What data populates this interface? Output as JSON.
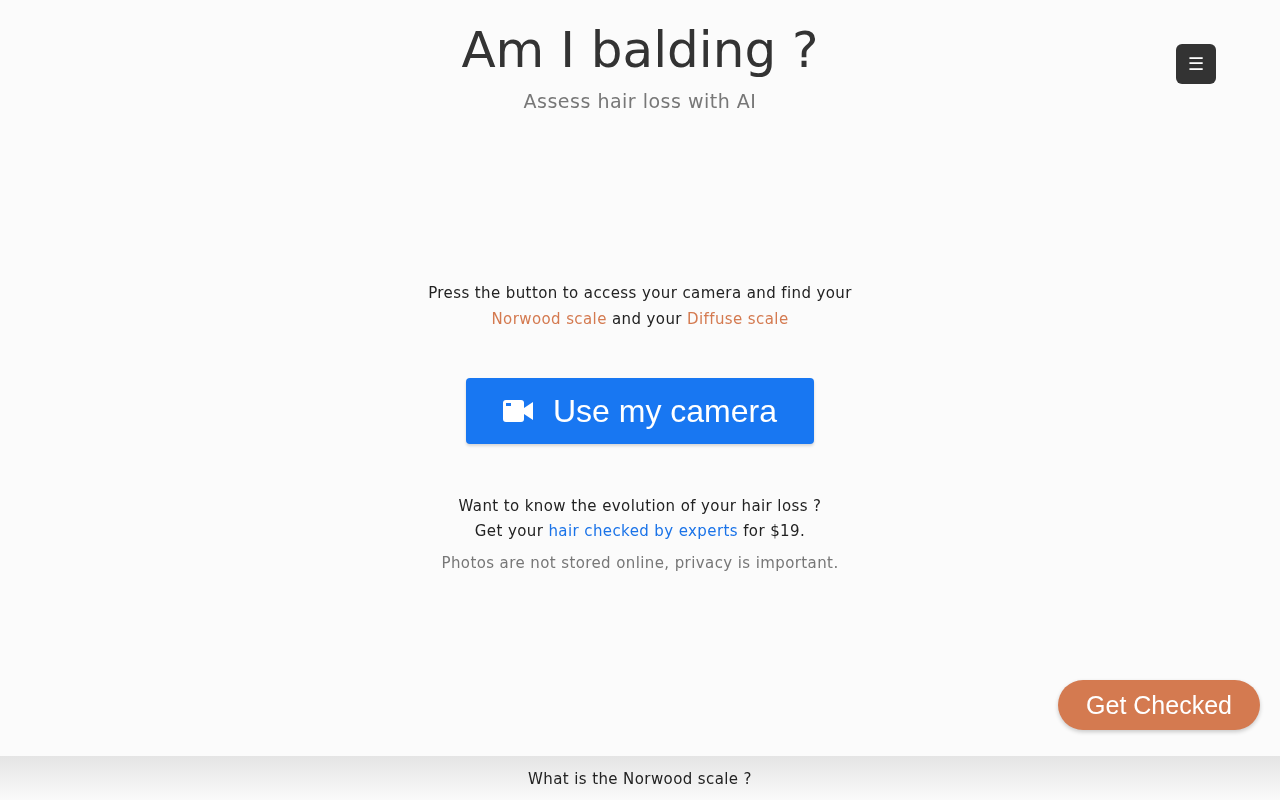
{
  "header": {
    "title": "Am I balding ?",
    "subtitle": "Assess hair loss with AI",
    "menu_icon": "☰"
  },
  "intro": [
    {
      "kind": "text",
      "text": "Press the button to access your camera and find your "
    },
    {
      "kind": "link",
      "text": "Norwood scale",
      "color": "#d47a50"
    },
    {
      "kind": "text",
      "text": " and your "
    },
    {
      "kind": "link",
      "text": "Diffuse scale",
      "color": "#d47a50"
    }
  ],
  "camera_button": {
    "label": "Use my camera"
  },
  "offer": [
    {
      "kind": "text",
      "text": "Want to know the evolution of your hair loss ?"
    },
    {
      "kind": "break"
    },
    {
      "kind": "text",
      "text": "Get your "
    },
    {
      "kind": "link",
      "text": "hair checked by experts",
      "color": "#1a73e8"
    },
    {
      "kind": "text",
      "text": " for $19."
    }
  ],
  "privacy_note": "Photos are not stored online, privacy is important.",
  "floating_button": {
    "label": "Get Checked"
  },
  "footer": {
    "label": "What is the Norwood scale ?"
  }
}
